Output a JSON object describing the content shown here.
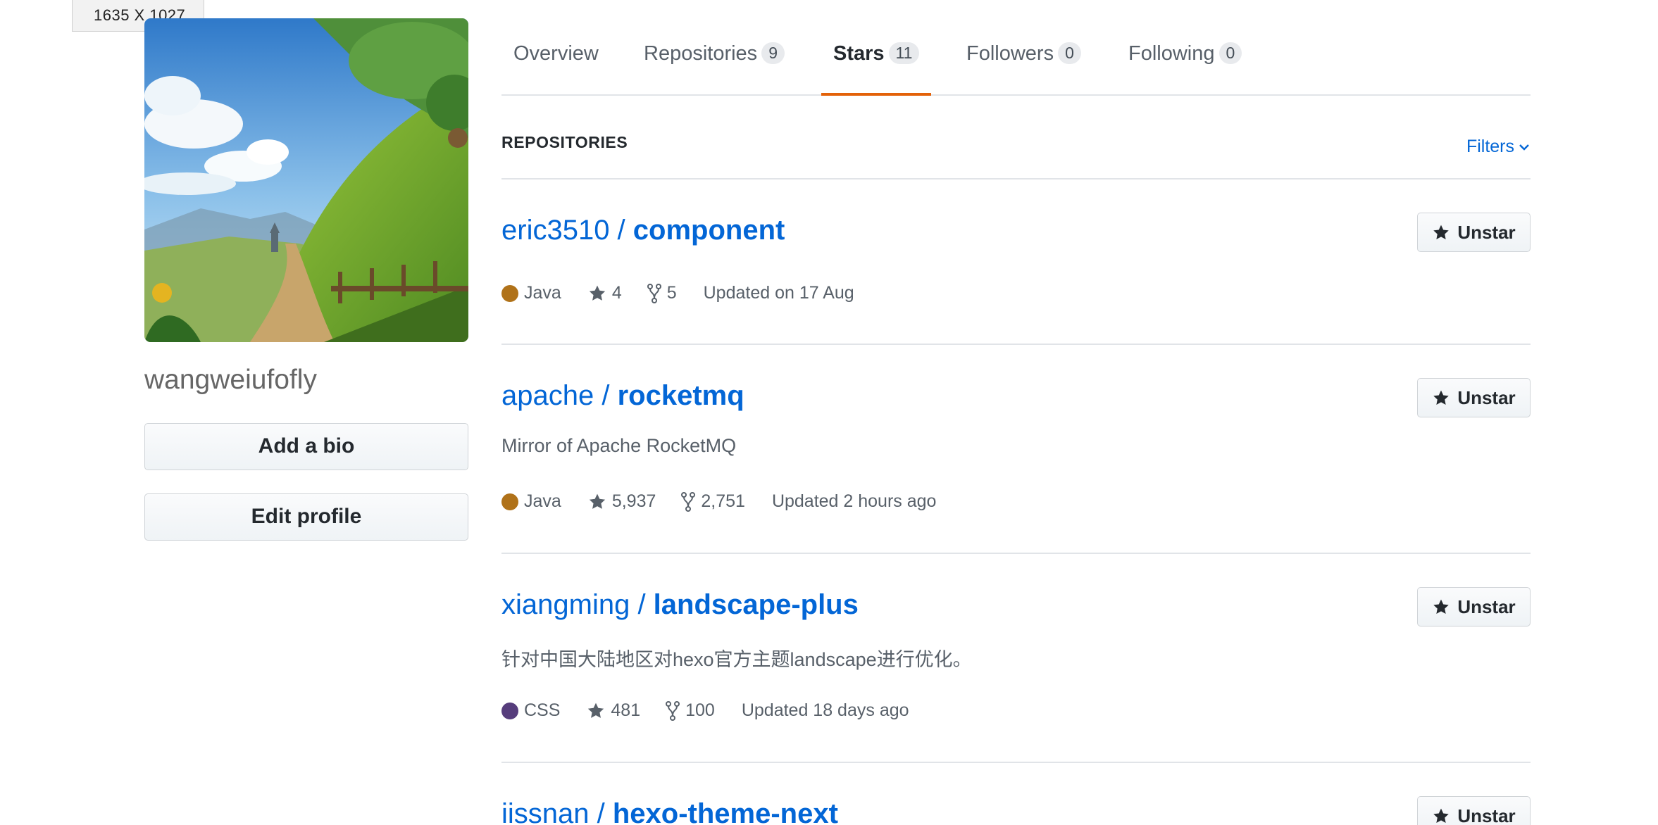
{
  "dimension_tooltip": "1635 X 1027",
  "profile": {
    "username": "wangweiufofly",
    "add_bio_label": "Add a bio",
    "edit_profile_label": "Edit profile"
  },
  "tabs": [
    {
      "label": "Overview",
      "count": null
    },
    {
      "label": "Repositories",
      "count": "9"
    },
    {
      "label": "Stars",
      "count": "11",
      "selected": true
    },
    {
      "label": "Followers",
      "count": "0"
    },
    {
      "label": "Following",
      "count": "0"
    }
  ],
  "section": {
    "title": "REPOSITORIES",
    "filters_label": "Filters"
  },
  "colors": {
    "link": "#0366d6",
    "tab_accent": "#e36209",
    "java": "#b07219",
    "css": "#563d7c"
  },
  "repos": [
    {
      "owner": "eric3510",
      "separator": " / ",
      "name": "component",
      "description": "",
      "language": "Java",
      "language_color": "#b07219",
      "stars": "4",
      "forks": "5",
      "updated": "Updated on 17 Aug",
      "button_label": "Unstar"
    },
    {
      "owner": "apache",
      "separator": " / ",
      "name": "rocketmq",
      "description": "Mirror of Apache RocketMQ",
      "language": "Java",
      "language_color": "#b07219",
      "stars": "5,937",
      "forks": "2,751",
      "updated": "Updated 2 hours ago",
      "button_label": "Unstar"
    },
    {
      "owner": "xiangming",
      "separator": " / ",
      "name": "landscape-plus",
      "description": "针对中国大陆地区对hexo官方主题landscape进行优化。",
      "language": "CSS",
      "language_color": "#563d7c",
      "stars": "481",
      "forks": "100",
      "updated": "Updated 18 days ago",
      "button_label": "Unstar"
    },
    {
      "owner": "iissnan",
      "separator": " / ",
      "name": "hexo-theme-next",
      "button_label": "Unstar"
    }
  ]
}
